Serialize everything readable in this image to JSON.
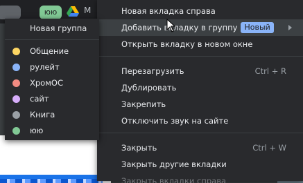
{
  "background": {
    "tab_chip_label": "юю",
    "truncated_tab_letter": "M"
  },
  "context_menu": {
    "items": [
      {
        "label": "Новая вкладка справа"
      },
      {
        "label": "Добавить вкладку в группу",
        "badge": "Новый",
        "has_submenu": true
      },
      {
        "label": "Открыть вкладку в новом окне"
      },
      {
        "label": "Перезагрузить",
        "shortcut": "Ctrl + R"
      },
      {
        "label": "Дублировать"
      },
      {
        "label": "Закрепить"
      },
      {
        "label": "Отключить звук на сайте"
      },
      {
        "label": "Закрыть",
        "shortcut": "Ctrl + W"
      },
      {
        "label": "Закрыть другие вкладки"
      },
      {
        "label": "Закрыть вкладки справа",
        "disabled": true
      }
    ]
  },
  "group_submenu": {
    "new_group_label": "Новая группа",
    "groups": [
      {
        "label": "Общение",
        "color": "#fdd663"
      },
      {
        "label": "рулейт",
        "color": "#8ab4f8"
      },
      {
        "label": "ХромОС",
        "color": "#f28b82"
      },
      {
        "label": "сайт",
        "color": "#d7aefb"
      },
      {
        "label": "Книга",
        "color": "#9aa0a6"
      },
      {
        "label": "юю",
        "color": "#81c995"
      }
    ]
  }
}
